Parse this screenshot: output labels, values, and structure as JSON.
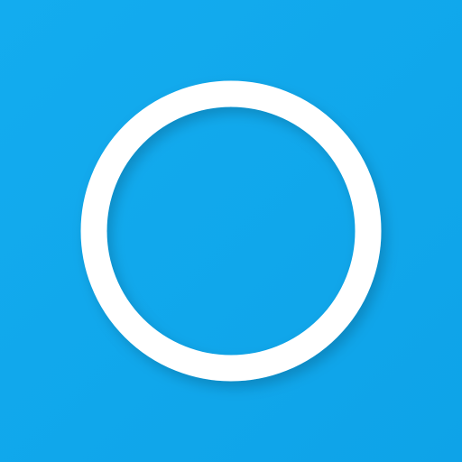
{
  "app_icon": {
    "icon_name": "circle-ring-icon",
    "background_color": "#13acef",
    "ring_color": "#ffffff"
  }
}
